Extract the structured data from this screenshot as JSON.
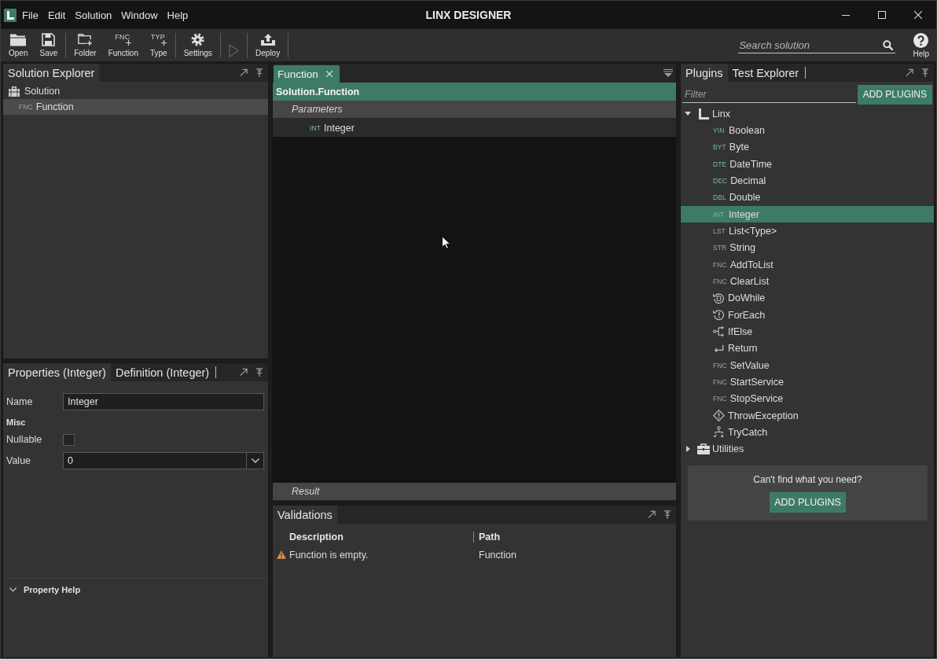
{
  "window": {
    "title": "LINX DESIGNER"
  },
  "menu": [
    "File",
    "Edit",
    "Solution",
    "Window",
    "Help"
  ],
  "toolbar": {
    "items": [
      {
        "kind": "open",
        "label": "Open",
        "disabled": false
      },
      {
        "kind": "save",
        "label": "Save",
        "disabled": false
      },
      {
        "kind": "separator"
      },
      {
        "kind": "folder",
        "label": "Folder",
        "disabled": false
      },
      {
        "kind": "code",
        "badge": "FNC",
        "label": "Function",
        "disabled": false
      },
      {
        "kind": "code",
        "badge": "TYP",
        "label": "Type",
        "disabled": false
      },
      {
        "kind": "separator"
      },
      {
        "kind": "settings",
        "label": "Settings",
        "disabled": false
      },
      {
        "kind": "separator"
      },
      {
        "kind": "run",
        "disabled": true
      },
      {
        "kind": "separator"
      },
      {
        "kind": "deploy",
        "label": "Deploy",
        "disabled": false
      },
      {
        "kind": "separator"
      }
    ],
    "search": {
      "placeholder": "Search solution"
    },
    "help": {
      "label": "Help"
    }
  },
  "solution_explorer": {
    "tabs": [
      {
        "label": "Solution Explorer",
        "selected": true
      }
    ],
    "tree": [
      {
        "kind": "solution",
        "label": "Solution",
        "selected": false,
        "children": [
          {
            "kind": "function",
            "badge": "FNC",
            "label": "Function",
            "selected": true
          }
        ]
      }
    ]
  },
  "properties": {
    "tabs": [
      {
        "label": "Properties (Integer)",
        "selected": true
      },
      {
        "label": "Definition (Integer)",
        "selected": false
      }
    ],
    "fields": [
      {
        "kind": "text",
        "label": "Name",
        "value": "Integer"
      },
      {
        "kind": "section",
        "label": "Misc"
      },
      {
        "kind": "checkbox",
        "label": "Nullable",
        "checked": false
      },
      {
        "kind": "dropdown",
        "label": "Value",
        "value": "0"
      }
    ],
    "help": {
      "title": "Property Help"
    }
  },
  "editor": {
    "tabs": [
      {
        "label": "Function",
        "selected": true
      }
    ],
    "header": "Solution.Function",
    "parameters": {
      "title": "Parameters",
      "items": [
        {
          "badge": "INT",
          "label": "Integer"
        }
      ]
    },
    "result": {
      "title": "Result"
    }
  },
  "validations": {
    "tabs": [
      {
        "label": "Validations",
        "selected": true
      }
    ],
    "columns": [
      "Description",
      "Path"
    ],
    "rows": [
      {
        "kind": "warning",
        "description": "Function is empty.",
        "path": "Function"
      }
    ]
  },
  "plugins": {
    "tabs": [
      {
        "label": "Plugins",
        "selected": true
      },
      {
        "label": "Test Explorer",
        "selected": false
      }
    ],
    "filter": {
      "placeholder": "Filter"
    },
    "add_button": "ADD PLUGINS",
    "tree": [
      {
        "kind": "library",
        "label": "Linx",
        "expanded": true,
        "selected": false,
        "children": [
          {
            "kind": "type",
            "badge": "Y\\N",
            "label": "Boolean",
            "selected": false
          },
          {
            "kind": "type",
            "badge": "BYT",
            "label": "Byte",
            "selected": false
          },
          {
            "kind": "type",
            "badge": "DTE",
            "label": "DateTime",
            "selected": false
          },
          {
            "kind": "type",
            "badge": "DEC",
            "label": "Decimal",
            "selected": false
          },
          {
            "kind": "type",
            "badge": "DBL",
            "label": "Double",
            "selected": false
          },
          {
            "kind": "type",
            "badge": "INT",
            "label": "Integer",
            "selected": true
          },
          {
            "kind": "type",
            "badge": "LST",
            "label": "List<Type>",
            "selected": false
          },
          {
            "kind": "type",
            "badge": "STR",
            "label": "String",
            "selected": false
          },
          {
            "kind": "function",
            "badge": "FNC",
            "label": "AddToList",
            "selected": false
          },
          {
            "kind": "function",
            "badge": "FNC",
            "label": "ClearList",
            "selected": false
          },
          {
            "kind": "loop",
            "label": "DoWhile",
            "selected": false
          },
          {
            "kind": "iterate",
            "label": "ForEach",
            "selected": false
          },
          {
            "kind": "branch",
            "label": "IfElse",
            "selected": false
          },
          {
            "kind": "return",
            "label": "Return",
            "selected": false
          },
          {
            "kind": "function",
            "badge": "FNC",
            "label": "SetValue",
            "selected": false
          },
          {
            "kind": "function",
            "badge": "FNC",
            "label": "StartService",
            "selected": false
          },
          {
            "kind": "function",
            "badge": "FNC",
            "label": "StopService",
            "selected": false
          },
          {
            "kind": "throw",
            "label": "ThrowException",
            "selected": false
          },
          {
            "kind": "trycatch",
            "label": "TryCatch",
            "selected": false
          }
        ]
      },
      {
        "kind": "toolbox",
        "label": "Utilities",
        "expanded": false,
        "selected": false
      }
    ],
    "hint": {
      "text": "Can't find what you need?",
      "button": "ADD PLUGINS"
    }
  }
}
